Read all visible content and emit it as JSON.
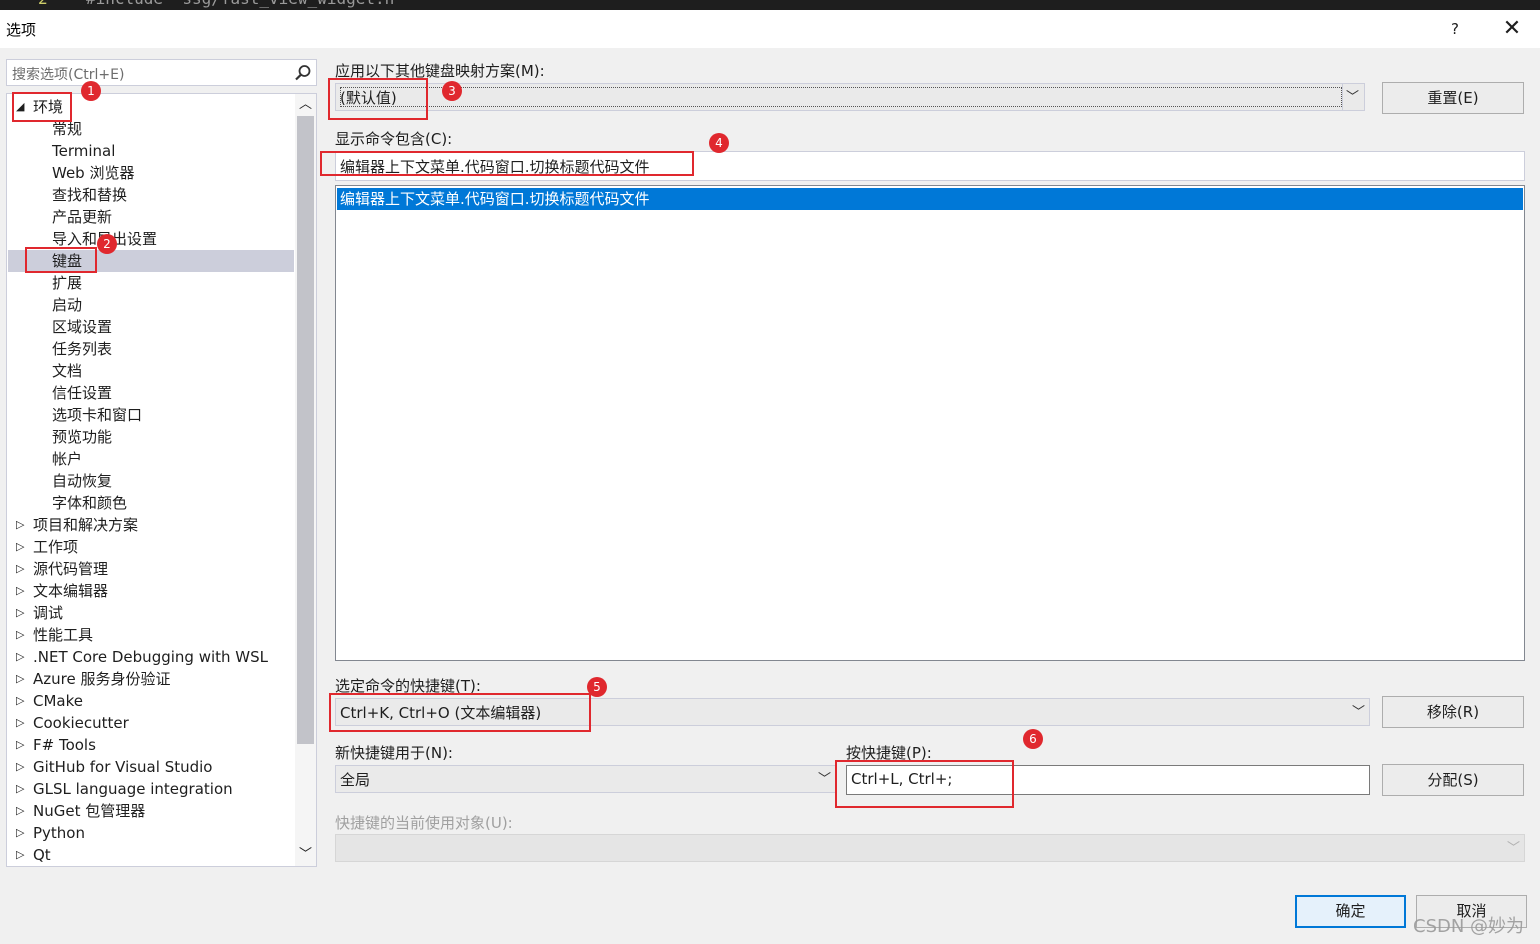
{
  "background_code": {
    "line_no": "2",
    "text": "#include \"ssg/fast_view_widget.h\""
  },
  "window": {
    "title": "选项",
    "help": "?",
    "close": "✕"
  },
  "search": {
    "placeholder": "搜索选项(Ctrl+E)"
  },
  "tree": {
    "root_expanded": "环境",
    "children": [
      "常规",
      "Terminal",
      "Web 浏览器",
      "查找和替换",
      "产品更新",
      "导入和导出设置",
      "键盘",
      "扩展",
      "启动",
      "区域设置",
      "任务列表",
      "文档",
      "信任设置",
      "选项卡和窗口",
      "预览功能",
      "帐户",
      "自动恢复",
      "字体和颜色"
    ],
    "selected_child": "键盘",
    "collapsed_roots": [
      "项目和解决方案",
      "工作项",
      "源代码管理",
      "文本编辑器",
      "调试",
      "性能工具",
      ".NET Core Debugging with WSL",
      "Azure 服务身份验证",
      "CMake",
      "Cookiecutter",
      "F# Tools",
      "GitHub for Visual Studio",
      "GLSL language integration",
      "NuGet 包管理器",
      "Python",
      "Qt"
    ]
  },
  "keyboard": {
    "mapping_label": "应用以下其他键盘映射方案(M):",
    "mapping_value": "(默认值)",
    "reset_button": "重置(E)",
    "show_commands_label": "显示命令包含(C):",
    "show_commands_value": "编辑器上下文菜单.代码窗口.切换标题代码文件",
    "command_list": [
      "编辑器上下文菜单.代码窗口.切换标题代码文件"
    ],
    "shortcuts_label": "选定命令的快捷键(T):",
    "shortcuts_value": "Ctrl+K, Ctrl+O (文本编辑器)",
    "remove_button": "移除(R)",
    "use_in_label": "新快捷键用于(N):",
    "use_in_value": "全局",
    "press_keys_label": "按快捷键(P):",
    "press_keys_value": "Ctrl+L, Ctrl+;",
    "assign_button": "分配(S)",
    "currently_used_label": "快捷键的当前使用对象(U):",
    "currently_used_value": ""
  },
  "footer": {
    "ok": "确定",
    "cancel": "取消"
  },
  "annotations": [
    "1",
    "2",
    "3",
    "4",
    "5",
    "6"
  ],
  "watermark": "CSDN @妙为",
  "colors": {
    "selection": "#0078d7",
    "annotation": "#e0282e",
    "tree_selected": "#cccedb"
  }
}
